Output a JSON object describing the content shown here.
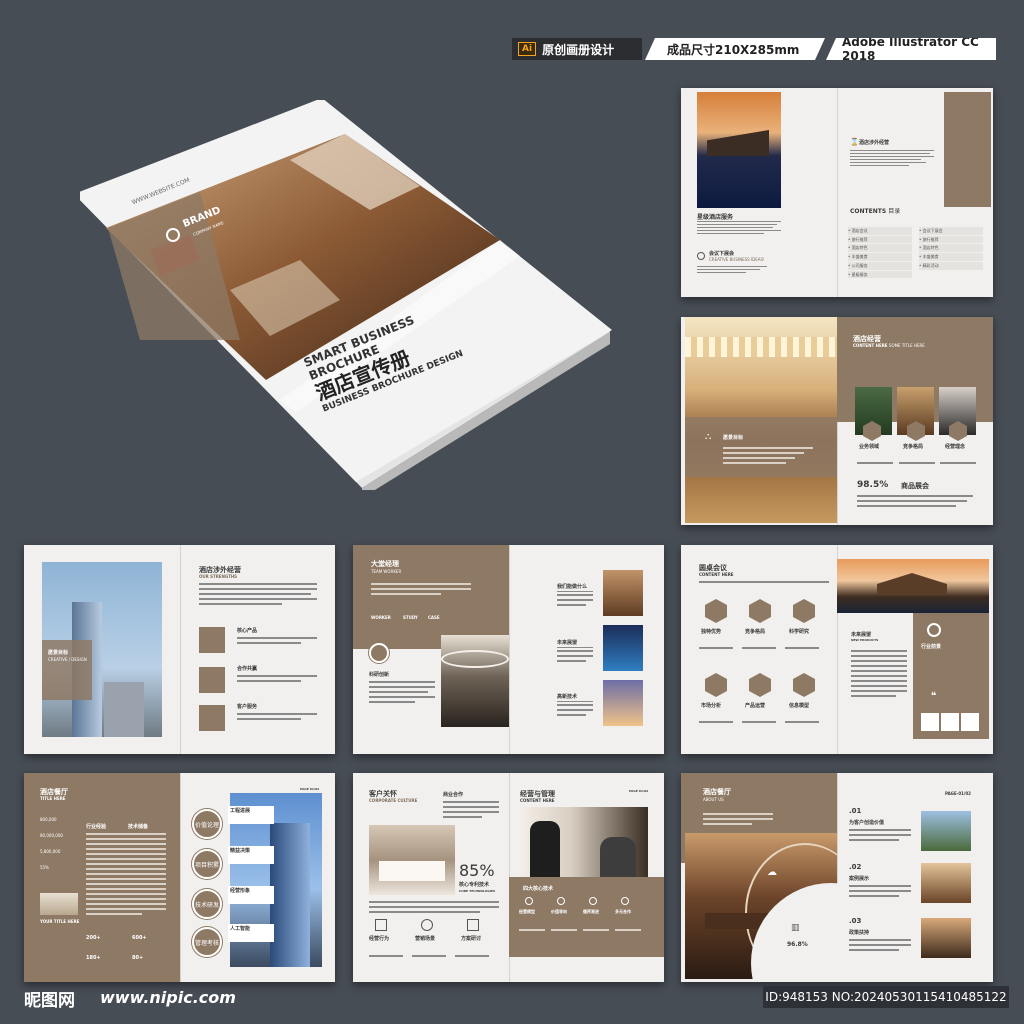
{
  "toolbar": {
    "ai_badge": "Ai",
    "tag1": "原创画册设计",
    "tag2": "成品尺寸210X285mm",
    "tag3": "Adobe Illustrator CC 2018"
  },
  "cover": {
    "website": "WWW.WEBSITE.COM",
    "brand": "BRAND",
    "brand_sub": "COMPANY NAME",
    "title_en1": "SMART BUSINESS",
    "title_en2": "BROCHURE",
    "title_cn": "酒店宣传册",
    "title_en3": "BUSINESS BROCHURE DESIGN"
  },
  "spread1": {
    "caption1": "星级酒店服务",
    "caption2": "会议下展会",
    "caption2_sub": "CREATIVE BUSINESS IDEAS!",
    "heading": "酒店涉外经营",
    "contents_title": "CONTENTS",
    "contents_cn": "目录",
    "toc_left": [
      "酒店会议",
      "旅行推荐",
      "酒店特色",
      "丰盛美食",
      "公司服务",
      "星级服务"
    ],
    "toc_right": [
      "会议下展会",
      "旅行推荐",
      "酒店特色",
      "丰盛美食",
      "精彩活动"
    ]
  },
  "spread2": {
    "title": "酒店经营",
    "subtitle": "CONTENT HERE",
    "subtitle2": "SOME TITLE HERE",
    "label": "愿景目标",
    "icons": [
      "业务领域",
      "竞争格局",
      "经营理念"
    ],
    "percent": "98.5%",
    "percent_label": "商品展会"
  },
  "spread3": {
    "title": "酒店涉外经营",
    "subtitle": "OUR STRENGTHS",
    "overlay_title": "愿景目标",
    "overlay_sub": "CREATIVE / DESIGN",
    "items": [
      "核心产品",
      "合作共赢",
      "客户服务"
    ]
  },
  "spread4": {
    "title": "大堂经理",
    "subtitle": "TEAM WORKER",
    "tabs": [
      "WORKER",
      "STUDY",
      "CASE"
    ],
    "label": "科研创新",
    "items": [
      "我们能做什么",
      "未来展望",
      "高新技术"
    ]
  },
  "spread5": {
    "title": "圆桌会议",
    "subtitle": "CONTENT HERE",
    "hex_labels": [
      "独特优势",
      "竞争格局",
      "科学研究",
      "市场分析",
      "产品运营",
      "信息模型"
    ],
    "right_title": "未来展望",
    "right_sub": "NEW PRODUCTS",
    "badge": "行业前景"
  },
  "spread6": {
    "title": "酒店餐厅",
    "subtitle": "TITLE HERE",
    "col1": "行业经验",
    "col2": "技术储备",
    "stats": [
      "800,000",
      "80,000,000",
      "5,800,000",
      "55%"
    ],
    "footer_title": "YOUR TITLE HERE",
    "stats2": [
      "200+",
      "600+",
      "180+",
      "80+"
    ],
    "circles": [
      "价值论理",
      "项目积累",
      "技术研发",
      "管理考核"
    ],
    "right_items": [
      "工程进展",
      "精益决策",
      "经营形象",
      "人工智能"
    ],
    "page": "PAGE 01/02"
  },
  "spread7": {
    "title": "客户关怀",
    "subtitle": "CORPORATE CULTURE",
    "label": "商业合作",
    "percent": "85%",
    "percent_label": "核心专利技术",
    "percent_sub": "CORE TECHNOLOGIES",
    "bottom": [
      "经营行为",
      "营销场景",
      "方案研讨"
    ],
    "right_title": "经营与管理",
    "right_sub": "CONTENT HERE",
    "page": "PAGE 01/02",
    "band_title": "四大核心技术",
    "band_items": [
      "经营模型",
      "价值导向",
      "循序渐进",
      "多元合作"
    ]
  },
  "spread8": {
    "title": "酒店餐厅",
    "subtitle": "ABOUT US",
    "page": "PAGE-01/02",
    "percent": "96.8%",
    "list": [
      {
        "num": ".01",
        "label": "为客户创造价值"
      },
      {
        "num": ".02",
        "label": "案例展示"
      },
      {
        "num": ".03",
        "label": "政策扶持"
      }
    ]
  },
  "footer": {
    "logo_cn": "昵图网",
    "url": "www.nipic.com",
    "id": "ID:948153 NO:20240530115410485122"
  },
  "colors": {
    "background": "#474d55",
    "accent": "#8e7965",
    "paper": "#f1f0ee"
  }
}
